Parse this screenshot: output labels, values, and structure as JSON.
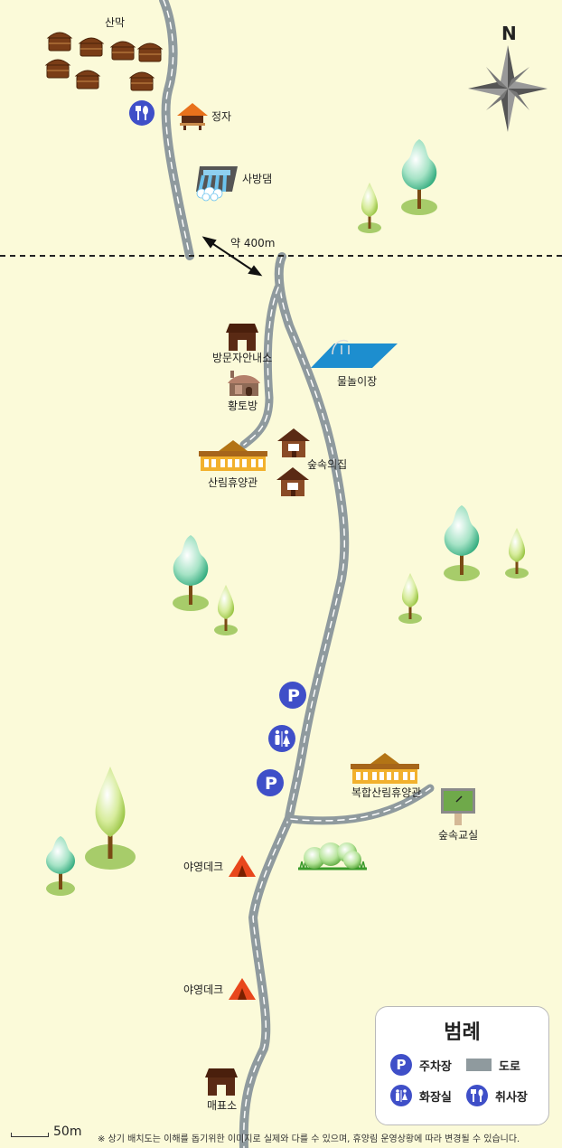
{
  "compass": {
    "label": "N"
  },
  "labels": {
    "yurts": "산막",
    "pavilion": "정자",
    "dam": "사방댐",
    "distance": "약 400m",
    "visitor_center": "방문자안내소",
    "water_play": "물놀이장",
    "clay_room": "황토방",
    "forest_house": "숲속의집",
    "forest_lodge": "산림휴양관",
    "complex_lodge": "복합산림휴양관",
    "forest_classroom": "숲속교실",
    "camp_deck_1": "야영데크",
    "camp_deck_2": "야영데크",
    "ticket_office": "매표소"
  },
  "legend": {
    "title": "범례",
    "parking": "주차장",
    "road": "도로",
    "toilet": "화장실",
    "cooking": "취사장"
  },
  "icons": {
    "parking_glyph": "P",
    "parking_color": "#3f4fc8",
    "road_color": "#8f9a9e",
    "building_color": "#5a2a14",
    "lodge_color": "#f2b12d",
    "tent_color": "#e8471c"
  },
  "scale": {
    "label": "50m"
  },
  "footnote": "※ 상기 배치도는 이해를 돕기위한 이미지로 실제와 다를 수 있으며, 휴양림 운영상황에 따라 변경될 수 있습니다."
}
